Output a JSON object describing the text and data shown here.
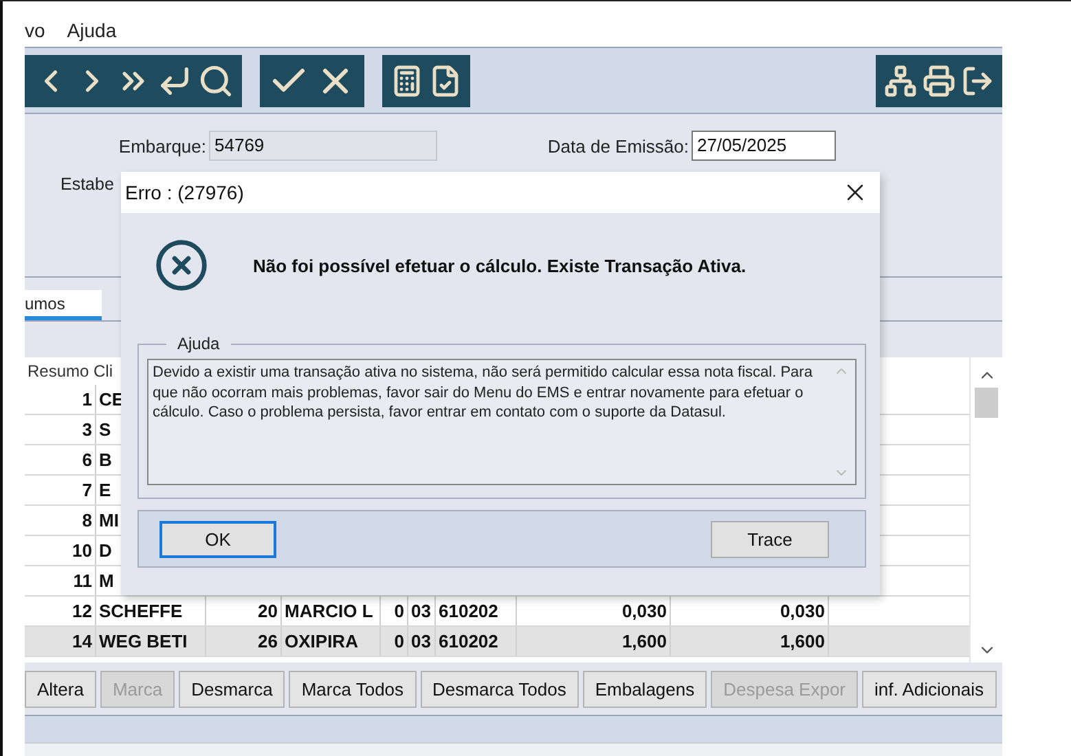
{
  "menu": [
    {
      "label": "vo"
    },
    {
      "label": "Ajuda"
    }
  ],
  "form": {
    "cut_label": "Estabe",
    "fields": [
      {
        "label": "Embarque:",
        "value": "54769",
        "disabled": true
      },
      {
        "label": "Data de Emissão:",
        "value": "27/05/2025",
        "disabled": false
      }
    ]
  },
  "tabs": [
    {
      "label": "umos",
      "selected": true
    }
  ],
  "table": {
    "header": "Resumo Cli",
    "rows": [
      {
        "cells": [
          "1",
          "CE"
        ],
        "selected": false
      },
      {
        "cells": [
          "3",
          "S"
        ],
        "selected": false
      },
      {
        "cells": [
          "6",
          "B"
        ],
        "selected": false
      },
      {
        "cells": [
          "7",
          "E"
        ],
        "selected": false
      },
      {
        "cells": [
          "8",
          "MI"
        ],
        "selected": false
      },
      {
        "cells": [
          "10",
          "D"
        ],
        "selected": false
      },
      {
        "cells": [
          "11",
          "M"
        ],
        "selected": false
      },
      {
        "cells": [
          "12",
          "SCHEFFE",
          "20",
          "MARCIO L",
          "0",
          "03",
          "610202",
          "0,030",
          "0,030"
        ],
        "selected": false
      },
      {
        "cells": [
          "14",
          "WEG BETI",
          "26",
          "OXIPIRA",
          "0",
          "03",
          "610202",
          "1,600",
          "1,600"
        ],
        "selected": true
      }
    ]
  },
  "buttons": [
    {
      "label": "Altera",
      "disabled": false
    },
    {
      "label": "Marca",
      "disabled": true
    },
    {
      "label": "Desmarca",
      "disabled": false
    },
    {
      "label": "Marca Todos",
      "disabled": false
    },
    {
      "label": "Desmarca Todos",
      "disabled": false
    },
    {
      "label": "Embalagens",
      "disabled": false
    },
    {
      "label": "Despesa Expor",
      "disabled": true
    },
    {
      "label": "inf. Adicionais",
      "disabled": false
    }
  ],
  "dialog": {
    "title": "Erro : (27976)",
    "message": "Não foi possível efetuar o cálculo. Existe Transação Ativa.",
    "help": {
      "legend": "Ajuda",
      "text": "Devido a existir uma transação ativa no sistema, não será permitido calcular essa nota fiscal. Para que não ocorram mais problemas, favor sair do Menu do EMS e entrar novamente para efetuar o cálculo. Caso o problema persista, favor entrar em contato com o suporte da Datasul."
    },
    "buttons": [
      {
        "label": "OK",
        "focused": true
      },
      {
        "label": "Trace",
        "focused": false
      }
    ]
  }
}
